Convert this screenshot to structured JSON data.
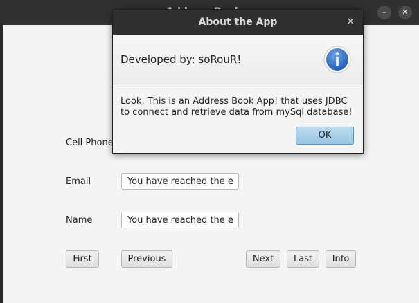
{
  "main_window": {
    "title": "Address Book",
    "labels": {
      "cell_phone": "Cell Phone",
      "email": "Email",
      "name": "Name"
    },
    "fields": {
      "email_value": "You have reached the e",
      "name_value": "You have reached the e"
    },
    "buttons": {
      "first": "First",
      "previous": "Previous",
      "next": "Next",
      "last": "Last",
      "info": "Info"
    },
    "window_controls": {
      "minimize": "–",
      "close": "✕"
    }
  },
  "dialog": {
    "title": "About the App",
    "close_glyph": "×",
    "header_text": "Developed by: soRouR!",
    "icon": "info-icon",
    "message_line1": "Look, This is an Address Book App! that uses JDBC",
    "message_line2": "to connect and retrieve data from mySql database!",
    "ok_label": "OK"
  },
  "colors": {
    "titlebar": "#303030",
    "window_bg": "#f4f4f4",
    "info_blue": "#2f6fc9",
    "ok_button": "#a9d1ea"
  }
}
